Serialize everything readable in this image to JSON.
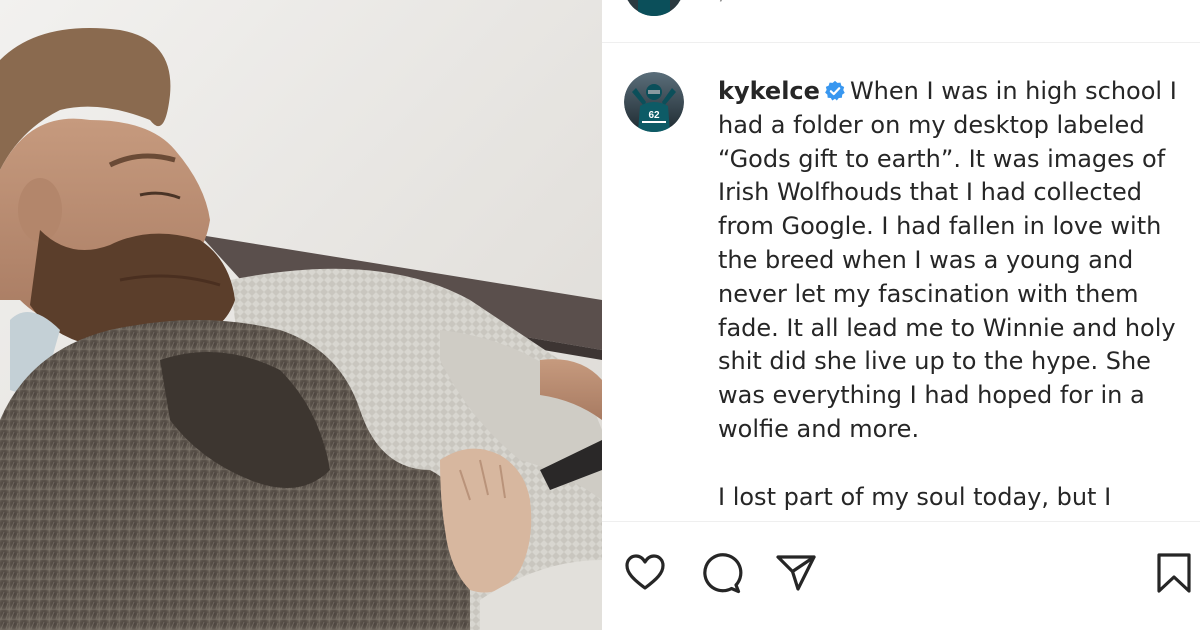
{
  "post": {
    "author": {
      "username": "kykelce",
      "verified": true,
      "avatar_icon": "profile-avatar-icon",
      "jersey_number": "62"
    },
    "caption": {
      "paragraph_1": "When I was in high school I had a folder on my desktop labeled “Gods gift to earth”. It was images of Irish Wolfhouds that I had collected from Google. I had fallen in love with the breed when I was a young and never let my fascination with them fade. It all lead me to Winnie and holy shit did she live up to the hype. She was everything I had hoped for in a wolfie and more.",
      "paragraph_2": "I lost part of my soul today, but I know that I"
    },
    "actions": {
      "like_icon": "heart-icon",
      "comment_icon": "comment-icon",
      "share_icon": "send-icon",
      "save_icon": "bookmark-icon"
    }
  },
  "colors": {
    "text": "#262626",
    "verified_blue": "#3897f0",
    "divider": "#efefef"
  }
}
